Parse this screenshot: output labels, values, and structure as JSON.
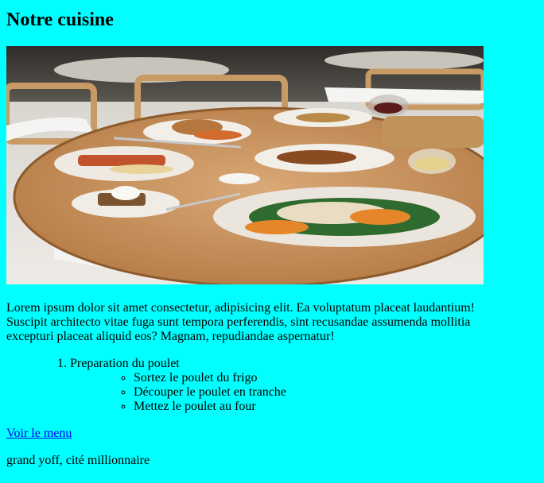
{
  "page": {
    "title": "Notre cuisine"
  },
  "hero_image": {
    "alt": "restaurant table with plates of food"
  },
  "intro_text": "Lorem ipsum dolor sit amet consectetur, adipisicing elit. Ea voluptatum placeat laudantium! Suscipit architecto vitae fuga sunt tempora perferendis, sint recusandae assumenda mollitia excepturi placeat aliquid eos? Magnam, repudiandae aspernatur!",
  "recipe": {
    "steps": [
      {
        "label": "Preparation du poulet",
        "substeps": [
          "Sortez le poulet du frigo",
          "Découper le poulet en tranche",
          "Mettez le poulet au four"
        ]
      }
    ]
  },
  "menu_link": "Voir le menu",
  "address": "grand yoff, cité millionnaire",
  "colors": {
    "background": "#00ffff",
    "link": "#0000ee"
  }
}
